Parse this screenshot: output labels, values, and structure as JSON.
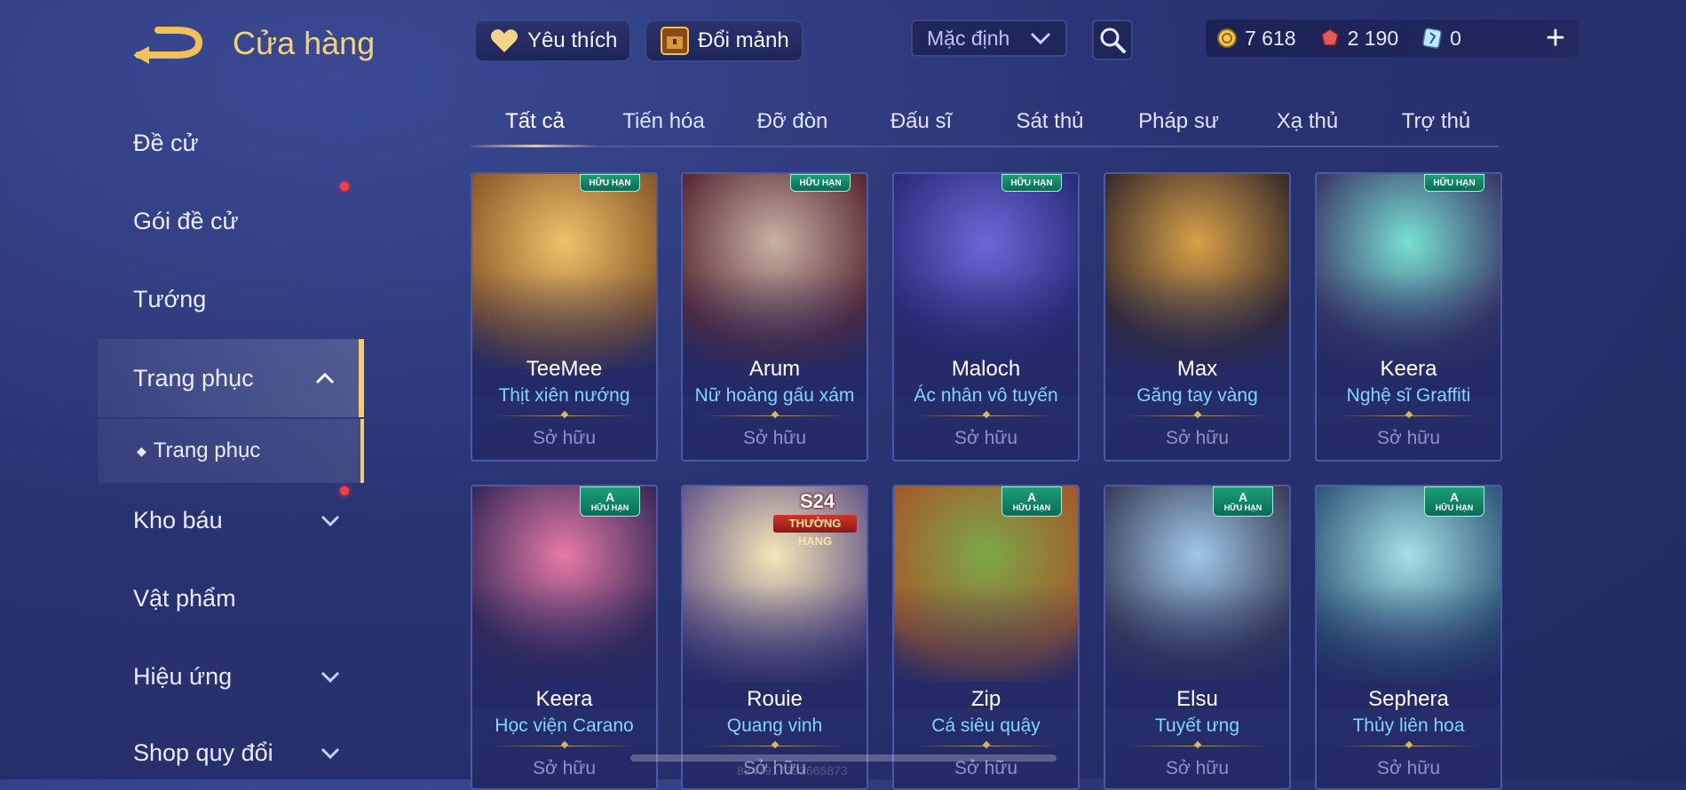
{
  "header": {
    "title": "Cửa hàng",
    "favorite_label": "Yêu thích",
    "exchange_label": "Đổi mảnh",
    "sort_value": "Mặc định",
    "currencies": [
      {
        "name": "coin-icon",
        "value": "7 618"
      },
      {
        "name": "gem-icon",
        "value": "2 190"
      },
      {
        "name": "ticket-icon",
        "value": "0"
      }
    ]
  },
  "sidebar": {
    "items": [
      {
        "label": "Đề cử"
      },
      {
        "label": "Gói đề cử"
      },
      {
        "label": "Tướng"
      },
      {
        "label": "Trang phục"
      },
      {
        "label": "Trang phục"
      },
      {
        "label": "Kho báu"
      },
      {
        "label": "Vật phẩm"
      },
      {
        "label": "Hiệu ứng"
      },
      {
        "label": "Shop quy đổi"
      }
    ]
  },
  "tabs": [
    "Tất cả",
    "Tiến hóa",
    "Đỡ đòn",
    "Đấu sĩ",
    "Sát thủ",
    "Pháp sư",
    "Xạ thủ",
    "Trợ thủ"
  ],
  "cards": [
    {
      "hero": "TeeMee",
      "skin": "Thịt xiên nướng",
      "status": "Sở hữu",
      "badge": "HỮU HẠN",
      "colors": [
        "#f0c16a",
        "#8a5a2a"
      ]
    },
    {
      "hero": "Arum",
      "skin": "Nữ hoàng gấu xám",
      "status": "Sở hữu",
      "badge": "HỮU HẠN",
      "colors": [
        "#c9b2a6",
        "#5a2a34"
      ]
    },
    {
      "hero": "Maloch",
      "skin": "Ác nhân vô tuyến",
      "status": "Sở hữu",
      "badge": "HỮU HẠN",
      "colors": [
        "#6a68d8",
        "#2a2c7a"
      ]
    },
    {
      "hero": "Max",
      "skin": "Găng tay vàng",
      "status": "Sở hữu",
      "badge": "",
      "colors": [
        "#d9a14a",
        "#3a2c2a"
      ]
    },
    {
      "hero": "Keera",
      "skin": "Nghệ sĩ Graffiti",
      "status": "Sở hữu",
      "badge": "HỮU HẠN",
      "colors": [
        "#7ae0d2",
        "#3a3a6a"
      ]
    },
    {
      "hero": "Keera",
      "skin": "Học viện Carano",
      "status": "Sở hữu",
      "badge": "HỮU HẠN",
      "rank": "A",
      "colors": [
        "#e57aa6",
        "#3a2a5a"
      ]
    },
    {
      "hero": "Rouie",
      "skin": "Quang vinh",
      "status": "Sở hữu",
      "badge": "",
      "ranked_label": "THƯỜNG HẠNG",
      "season_label": "S24",
      "colors": [
        "#f6e7b8",
        "#6a5a8a"
      ]
    },
    {
      "hero": "Zip",
      "skin": "Cá siêu quậy",
      "status": "Sở hữu",
      "badge": "HỮU HẠN",
      "rank": "A",
      "colors": [
        "#7ca84a",
        "#a35a2a"
      ]
    },
    {
      "hero": "Elsu",
      "skin": "Tuyết ưng",
      "status": "Sở hữu",
      "badge": "HỮU HẠN",
      "rank": "A",
      "colors": [
        "#9fc8ea",
        "#3a3f5a"
      ]
    },
    {
      "hero": "Sephera",
      "skin": "Thủy liên hoa",
      "status": "Sở hữu",
      "badge": "HỮU HẠN",
      "rank": "A",
      "colors": [
        "#a7e0e6",
        "#2f5a7a"
      ]
    }
  ],
  "footer": {
    "id_text": "8347917393665873"
  }
}
